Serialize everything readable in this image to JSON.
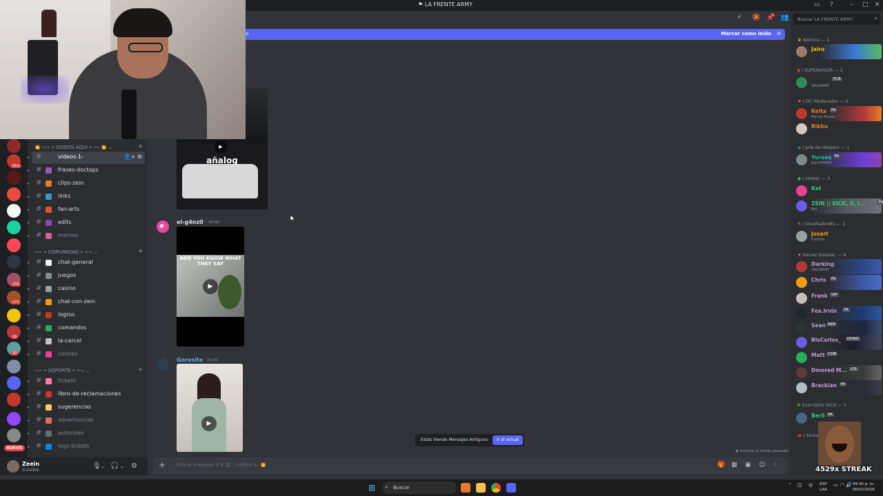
{
  "window": {
    "title": "LA FRENTE ARMY",
    "title_icon": "discord-flag-icon"
  },
  "header": {
    "search_placeholder": "Buscar LA FRENTE ARMY"
  },
  "banner": {
    "left_text": "o",
    "mark_read_label": "Marcar como leído"
  },
  "channels": {
    "categories": [
      {
        "label": "👏 ›››› • VIDEOS AQUI • ‹‹‹ 👏 ⌄"
      },
      {
        "label": "›››› • COMUNIDAD • ‹‹‹‹ ⌄"
      },
      {
        "label": "›››› • SOPORTE • ‹‹‹‹ ⌄"
      }
    ],
    "items": [
      {
        "label": "videos-1-",
        "emoji_color": "#3f4147",
        "active": true
      },
      {
        "label": "frases-doctops",
        "emoji_color": "#9b59b6"
      },
      {
        "label": "clips-zein",
        "emoji_color": "#e67e22"
      },
      {
        "label": "links",
        "emoji_color": "#3498db"
      },
      {
        "label": "fan-arts",
        "emoji_color": "#e74c3c"
      },
      {
        "label": "edits",
        "emoji_color": "#8e44ad"
      },
      {
        "label": "memes",
        "emoji_color": "#d35d9a",
        "muted": true
      },
      {
        "label": "chat-general",
        "emoji_color": "#ecf0f1"
      },
      {
        "label": "juegos",
        "emoji_color": "#7f8c8d"
      },
      {
        "label": "casino",
        "emoji_color": "#95a5a6"
      },
      {
        "label": "chat-con-zein",
        "emoji_color": "#f39c12"
      },
      {
        "label": "logros",
        "emoji_color": "#c0392b"
      },
      {
        "label": "comandos",
        "emoji_color": "#27ae60"
      },
      {
        "label": "la-carcel",
        "emoji_color": "#bdc3c7"
      },
      {
        "label": "colores",
        "emoji_color": "#e84393",
        "muted": true
      },
      {
        "label": "tickets",
        "emoji_color": "#fd79a8",
        "muted": true
      },
      {
        "label": "libro-de-reclamaciones",
        "emoji_color": "#d63031"
      },
      {
        "label": "sugerencias",
        "emoji_color": "#fdcb6e"
      },
      {
        "label": "advertencias",
        "emoji_color": "#e17055",
        "muted": true
      },
      {
        "label": "autoroles",
        "emoji_color": "#636e72",
        "muted": true
      },
      {
        "label": "logs-tickets",
        "emoji_color": "#0984e3",
        "muted": true
      }
    ]
  },
  "servers": [
    {
      "color": "#8e2a2a"
    },
    {
      "color": "#c0392b",
      "badge": "1K+"
    },
    {
      "color": "#5a1a1a"
    },
    {
      "color": "#e74c3c"
    },
    {
      "color": "#f5f5f5"
    },
    {
      "color": "#1dd1a1"
    },
    {
      "color": "#ff4757"
    },
    {
      "color": "#2f3542"
    },
    {
      "color": "#a4505f",
      "badge": "333"
    },
    {
      "color": "#a0522d",
      "badge": "177"
    },
    {
      "color": "#f1c40f"
    },
    {
      "color": "#b33939",
      "badge": "16"
    },
    {
      "color": "#5f9ea0",
      "badge": "30"
    },
    {
      "color": "#7f8fa6"
    },
    {
      "color": "#5865f2"
    },
    {
      "color": "#c0392b"
    },
    {
      "color": "#9146ff"
    },
    {
      "color": "#888888"
    }
  ],
  "nuevo_label": "NUEVO",
  "user": {
    "name": "Zeein",
    "status": "Invisible"
  },
  "messages": [
    {
      "author": "el-g4nz0",
      "time": "20:32",
      "author_color": "#dbdee1"
    },
    {
      "author": "Gorosito",
      "time": "20:32",
      "author_color": "#5dade2"
    }
  ],
  "video_overlay_text": "añalog",
  "video_caption": "AND YOU KNOW WHAT THEY SAY",
  "old_messages": {
    "text": "Estás Viendo Mensajes Antiguos",
    "button": "Ir al actual"
  },
  "immune_text": "Inmune al modo pausado",
  "input_placeholder": "Enviar mensaje a # 🎥 | videos-1- 👏",
  "members": {
    "roles": [
      {
        "label": "Admins — 1"
      },
      {
        "label": "| SUPERVISOR — 1"
      },
      {
        "label": "| DC Moderador — 2"
      },
      {
        "label": "| Jefe de Helpers — 1"
      },
      {
        "label": "| Helper — 2"
      },
      {
        "label": "| DiseñadorÆs — 1"
      },
      {
        "label": "Server booster — 9"
      },
      {
        "label": "Suscriptor KICK — 1"
      },
      {
        "label": "| Stream"
      }
    ],
    "list": [
      {
        "name": "Jairo",
        "color": "#f1c40f",
        "sub": ""
      },
      {
        "name": "",
        "color": "#e74c3c",
        "tag": "FCB",
        "sub": "VALORANT"
      },
      {
        "name": "Keita",
        "color": "#e67e22",
        "tag": "FA",
        "sub": "Marvel Rivals"
      },
      {
        "name": "Rikhu",
        "color": "#e67e22",
        "sub": ""
      },
      {
        "name": "Yuraaq",
        "color": "#1abc9c",
        "tag": "FA",
        "sub": "KLOuFRENS"
      },
      {
        "name": "Kat",
        "color": "#2ecc71",
        "sub": ""
      },
      {
        "name": "ZEIN || KICK, X, I...",
        "color": "#2ecc71",
        "tag": "FA",
        "sub": "Bot"
      },
      {
        "name": "Josart",
        "color": "#f39c12",
        "sub": "Fortnite"
      },
      {
        "name": "Darking",
        "color": "#c39bd3",
        "sub": "VALORANT"
      },
      {
        "name": "Chris",
        "color": "#c39bd3",
        "tag": "FA",
        "sub": ""
      },
      {
        "name": "Frank",
        "color": "#c39bd3",
        "tag": "VIP",
        "sub": ""
      },
      {
        "name": "Fox.Irvin",
        "color": "#c39bd3",
        "tag": "FA",
        "sub": ""
      },
      {
        "name": "Sean",
        "color": "#c39bd3",
        "tag": "REE",
        "sub": ""
      },
      {
        "name": "BlsCxrlos_",
        "color": "#c39bd3",
        "tag": "OHNO",
        "sub": ""
      },
      {
        "name": "Matt",
        "color": "#c39bd3",
        "tag": "COB",
        "sub": ""
      },
      {
        "name": "Dmored M...",
        "color": "#c39bd3",
        "tag": "LOL",
        "sub": ""
      },
      {
        "name": "Brackian",
        "color": "#c39bd3",
        "tag": "FA",
        "sub": ""
      },
      {
        "name": "BerS",
        "color": "#2ecc71",
        "tag": "FA",
        "sub": ""
      }
    ]
  },
  "streak": "4529x STREAK",
  "taskbar": {
    "search": "Buscar",
    "lang_top": "ESP",
    "lang_bottom": "LAA",
    "time": "09:40 p. m.",
    "date": "06/02/2026"
  },
  "colors": {
    "blurple": "#5865f2",
    "background": "#313338",
    "sidebar": "#2b2d31"
  }
}
